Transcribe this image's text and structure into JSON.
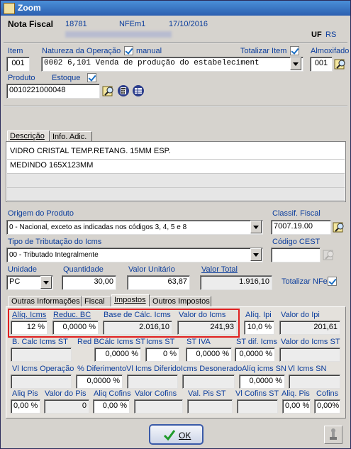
{
  "window": {
    "title": "Zoom"
  },
  "header": {
    "section": "Nota Fiscal",
    "number": "18781",
    "type": "NFEm1",
    "date": "17/10/2016",
    "uf_label": "UF",
    "uf_value": "RS"
  },
  "item": {
    "label": "Item",
    "value": "001"
  },
  "natureza": {
    "label": "Natureza da Operação",
    "manual_label": "manual",
    "value": "0002   6,101  Venda de produção do estabeleciment"
  },
  "totalizar_item": {
    "label": "Totalizar Item"
  },
  "almoxifado": {
    "label": "Almoxifado",
    "value": "001"
  },
  "produto": {
    "label": "Produto",
    "value": "0010221000048"
  },
  "estoque": {
    "label": "Estoque"
  },
  "desc_tabs": [
    "Descrição",
    "Info. Adic."
  ],
  "descricao": [
    "VIDRO CRISTAL TEMP.RETANG. 15MM ESP.",
    "MEDINDO 165X123MM",
    "",
    ""
  ],
  "origem": {
    "label": "Origem do Produto",
    "value": "0 - Nacional, exceto as indicadas nos códigos 3, 4, 5 e 8"
  },
  "classif": {
    "label": "Classif. Fiscal",
    "value": "7007.19.00"
  },
  "tributacao": {
    "label": "Tipo de Tributação do Icms",
    "value": "00 - Tributado Integralmente"
  },
  "cest": {
    "label": "Código CEST",
    "value": ""
  },
  "unidade": {
    "label": "Unidade",
    "value": "PC"
  },
  "quantidade": {
    "label": "Quantidade",
    "value": "30,00"
  },
  "valor_unitario": {
    "label": "Valor Unitário",
    "value": "63,87"
  },
  "valor_total": {
    "label": "Valor Total",
    "value": "1.916,10"
  },
  "totalizar_nfe": {
    "label": "Totalizar NFe"
  },
  "tax_tabs": [
    "Outras Informações",
    "Fiscal",
    "Impostos",
    "Outros Impostos"
  ],
  "row1": {
    "aliq_icms": {
      "label": "Alíq. Icms",
      "value": "12 %"
    },
    "reduc_bc": {
      "label": "Reduc. BC",
      "value": "0,0000 %"
    },
    "base_calc": {
      "label": "Base de Cálc. Icms",
      "value": "2.016,10"
    },
    "valor_icms": {
      "label": "Valor do Icms",
      "value": "241,93"
    },
    "aliq_ipi": {
      "label": "Alíq. Ipi",
      "value": "10,0 %"
    },
    "valor_ipi": {
      "label": "Valor do Ipi",
      "value": "201,61"
    }
  },
  "row2": {
    "b_calc_st": {
      "label": "B. Calc Icms ST",
      "value": ""
    },
    "red_bc_st": {
      "label": "Red BCálc Icms ST",
      "value": "0,0000 %"
    },
    "icms_st": {
      "label": "Icms ST",
      "value": "0 %"
    },
    "st_iva": {
      "label": "ST IVA",
      "value": "0,0000 %"
    },
    "st_dif": {
      "label": "ST dif. Icms",
      "value": "0,0000 %"
    },
    "valor_st": {
      "label": "Valor do Icms ST",
      "value": ""
    }
  },
  "row3": {
    "vl_icms_op": {
      "label": "Vl Icms Operação",
      "value": ""
    },
    "diferimento": {
      "label": "% Diferimento",
      "value": "0,0000 %"
    },
    "vl_dif": {
      "label": "Vl Icms Diferido",
      "value": ""
    },
    "desonerado": {
      "label": "Icms Desonerado",
      "value": ""
    },
    "aliq_sn": {
      "label": "Alíq icms SN",
      "value": "0,0000 %"
    },
    "vl_sn": {
      "label": "Vl Icms SN",
      "value": ""
    }
  },
  "row4": {
    "aliq_pis": {
      "label": "Aliq Pis",
      "value": "0,00 %"
    },
    "valor_pis": {
      "label": "Valor do Pis",
      "value": "0"
    },
    "aliq_cofins": {
      "label": "Aliq Cofins",
      "value": "0,00 %"
    },
    "valor_cofins": {
      "label": "Valor Cofins",
      "value": ""
    },
    "val_pis_st": {
      "label": "Val. Pis ST",
      "value": ""
    },
    "vl_cofins_st": {
      "label": "Vl Cofins ST",
      "value": ""
    },
    "aliq_pis2": {
      "label": "Aliq. Pis",
      "value": "0,00 %"
    },
    "cofins": {
      "label": "Cofins",
      "value": "0,00%"
    }
  },
  "ok_button": {
    "label": "OK"
  },
  "colors": {
    "title_bar": "#2c5fb0",
    "label_blue": "#0b3d9c",
    "highlight": "#e02020",
    "window_bg": "#d6d3ce"
  }
}
